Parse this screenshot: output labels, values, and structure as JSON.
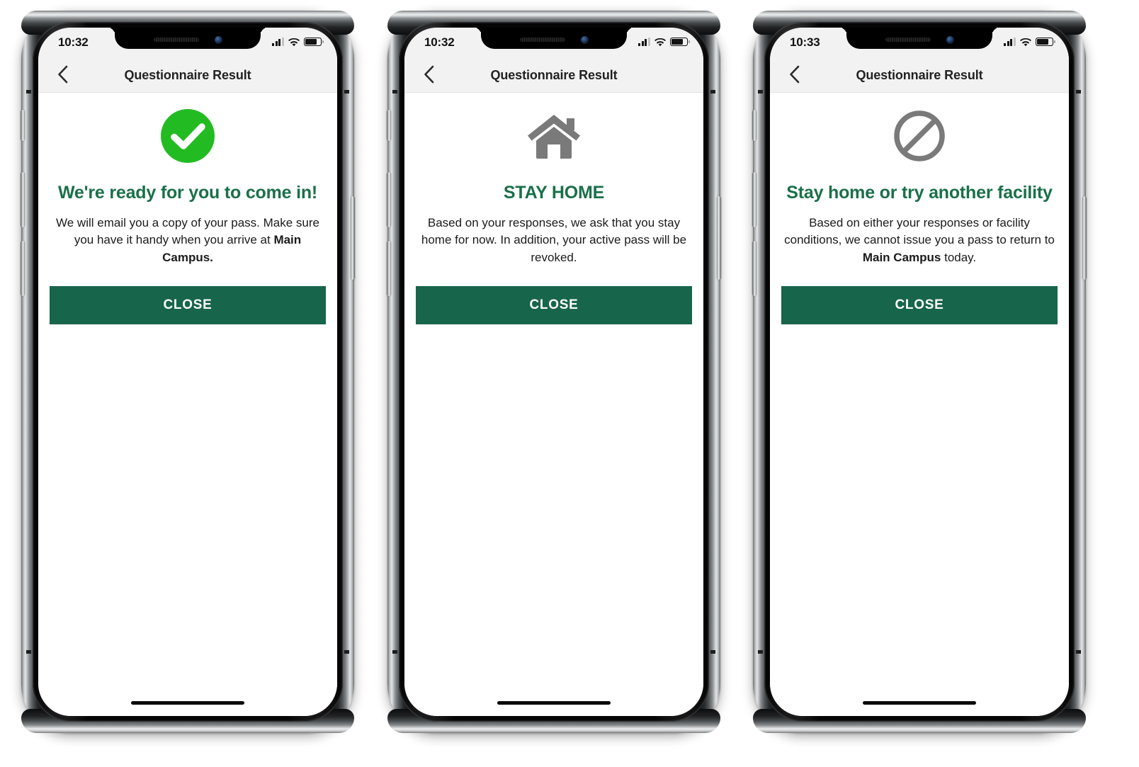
{
  "colors": {
    "brand_green": "#17654A",
    "title_green": "#1A7049",
    "success_green": "#22BB22",
    "icon_gray": "#7A7A7A",
    "statusbar_bg": "#F2F2F2",
    "screen_bg": "#FFFFFF",
    "text_dark": "#1B1B1B"
  },
  "phones": [
    {
      "id": "phone-success",
      "statusbar": {
        "time": "10:32",
        "signal_icon": "cellular-signal-icon",
        "wifi_icon": "wifi-icon",
        "battery_icon": "battery-icon"
      },
      "navbar": {
        "back_icon": "chevron-left-icon",
        "title": "Questionnaire Result"
      },
      "result": {
        "icon": "check-circle-icon",
        "icon_color": "#22BB22",
        "title": "We're ready for you to come in!",
        "title_color": "#1A7049",
        "body_before": "We will email you a copy of your pass. Make sure you have it handy when you arrive at ",
        "body_bold": "Main Campus.",
        "body_after": ""
      },
      "close_button": {
        "label": "CLOSE",
        "color": "#17654A"
      }
    },
    {
      "id": "phone-stay-home",
      "statusbar": {
        "time": "10:32",
        "signal_icon": "cellular-signal-icon",
        "wifi_icon": "wifi-icon",
        "battery_icon": "battery-icon"
      },
      "navbar": {
        "back_icon": "chevron-left-icon",
        "title": "Questionnaire Result"
      },
      "result": {
        "icon": "house-icon",
        "icon_color": "#7A7A7A",
        "title": "STAY HOME",
        "title_color": "#1A7049",
        "body_before": "Based on your responses, we ask that you stay home for now. In addition, your active pass will be revoked.",
        "body_bold": "",
        "body_after": ""
      },
      "close_button": {
        "label": "CLOSE",
        "color": "#17654A"
      }
    },
    {
      "id": "phone-denied",
      "statusbar": {
        "time": "10:33",
        "signal_icon": "cellular-signal-icon",
        "wifi_icon": "wifi-icon",
        "battery_icon": "battery-icon"
      },
      "navbar": {
        "back_icon": "chevron-left-icon",
        "title": "Questionnaire Result"
      },
      "result": {
        "icon": "prohibited-icon",
        "icon_color": "#7A7A7A",
        "title": "Stay home or try another facility",
        "title_color": "#1A7049",
        "body_before": "Based on either your responses or facility conditions, we cannot issue you a pass to return to ",
        "body_bold": "Main Campus",
        "body_after": " today."
      },
      "close_button": {
        "label": "CLOSE",
        "color": "#17654A"
      }
    }
  ]
}
